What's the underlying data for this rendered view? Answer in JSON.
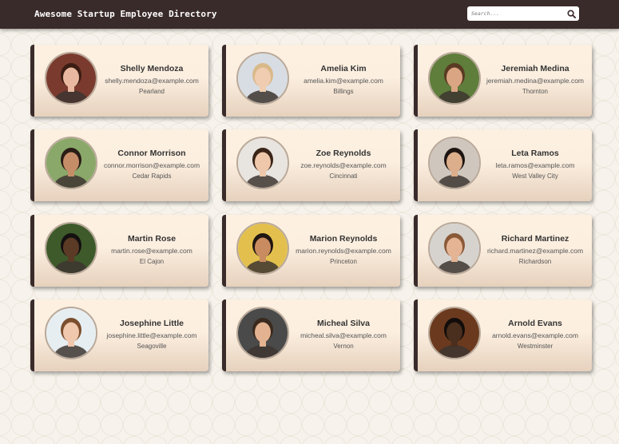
{
  "header": {
    "title": "Awesome Startup Employee Directory",
    "search_placeholder": "Search...",
    "search_icon": "search-icon"
  },
  "colors": {
    "header_bg": "#3a2b2b",
    "card_top": "#fdf0e0",
    "card_bottom": "#e6d1bd",
    "card_accent": "#3a2b2b"
  },
  "employees": [
    {
      "name": "Shelly Mendoza",
      "email": "shelly.mendoza@example.com",
      "city": "Pearland",
      "bg": "#7a3b2e",
      "skin": "#e8b9a0",
      "hair": "#3b1d14"
    },
    {
      "name": "Amelia Kim",
      "email": "amelia.kim@example.com",
      "city": "Billings",
      "bg": "#d8dde3",
      "skin": "#f0cdb0",
      "hair": "#d9b98a"
    },
    {
      "name": "Jeremiah Medina",
      "email": "jeremiah.medina@example.com",
      "city": "Thornton",
      "bg": "#5f7d3b",
      "skin": "#d9a583",
      "hair": "#5a3a22"
    },
    {
      "name": "Connor Morrison",
      "email": "connor.morrison@example.com",
      "city": "Cedar Rapids",
      "bg": "#8aa86a",
      "skin": "#c58e68",
      "hair": "#2a1d16"
    },
    {
      "name": "Zoe Reynolds",
      "email": "zoe.reynolds@example.com",
      "city": "Cincinnati",
      "bg": "#e8e4df",
      "skin": "#efc7aa",
      "hair": "#3a2418"
    },
    {
      "name": "Leta Ramos",
      "email": "leta.ramos@example.com",
      "city": "West Valley City",
      "bg": "#cfc6be",
      "skin": "#dcae8c",
      "hair": "#1e1512"
    },
    {
      "name": "Martin Rose",
      "email": "martin.rose@example.com",
      "city": "El Cajon",
      "bg": "#3e5a2a",
      "skin": "#5b3a26",
      "hair": "#141010"
    },
    {
      "name": "Marion Reynolds",
      "email": "marion.reynolds@example.com",
      "city": "Princeton",
      "bg": "#e3c04d",
      "skin": "#c98b60",
      "hair": "#201612"
    },
    {
      "name": "Richard Martinez",
      "email": "richard.martinez@example.com",
      "city": "Richardson",
      "bg": "#d6d3cf",
      "skin": "#e4b495",
      "hair": "#8a5a38"
    },
    {
      "name": "Josephine Little",
      "email": "josephine.little@example.com",
      "city": "Seagoville",
      "bg": "#e7eef2",
      "skin": "#f0c8ae",
      "hair": "#7a4e2e"
    },
    {
      "name": "Micheal Silva",
      "email": "micheal.silva@example.com",
      "city": "Vernon",
      "bg": "#4a4a4a",
      "skin": "#e3b290",
      "hair": "#3a2a1e"
    },
    {
      "name": "Arnold Evans",
      "email": "arnold.evans@example.com",
      "city": "Westminster",
      "bg": "#6b3a1e",
      "skin": "#4a2e1e",
      "hair": "#120d0b"
    }
  ]
}
